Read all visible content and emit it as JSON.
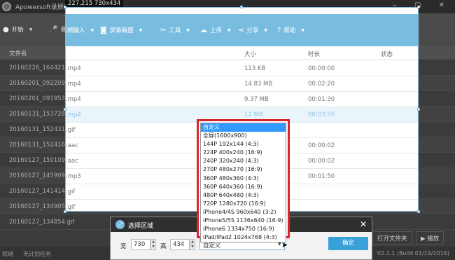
{
  "app": {
    "title": "Apowersoft录屏王",
    "window_controls": "‒ ▢ ✕"
  },
  "selection": {
    "coords_label": "227,215  730x434"
  },
  "toolbar": {
    "items": [
      {
        "label": "开始",
        "icon": "record-icon",
        "glyph": "●"
      },
      {
        "label": "音频输入",
        "icon": "microphone-icon",
        "glyph": "🎙"
      },
      {
        "label": "屏幕截图",
        "icon": "camera-icon",
        "glyph": "📷"
      },
      {
        "label": "工具",
        "icon": "tools-icon",
        "glyph": "✂"
      },
      {
        "label": "上传",
        "icon": "cloud-upload-icon",
        "glyph": "☁"
      },
      {
        "label": "分享",
        "icon": "share-icon",
        "glyph": "⋖"
      },
      {
        "label": "帮助",
        "icon": "help-icon",
        "glyph": "?"
      }
    ]
  },
  "table": {
    "headers": {
      "name": "文件名",
      "size": "大小",
      "duration": "时长",
      "status": "状态"
    },
    "rows": [
      {
        "name": "20160226_164421.mp4",
        "size": "113 KB",
        "duration": "00:00:00"
      },
      {
        "name": "20160201_092209.mp4",
        "size": "14.83 MB",
        "duration": "00:02:20"
      },
      {
        "name": "20160201_091953.mp4",
        "size": "9.37 MB",
        "duration": "00:01:30"
      },
      {
        "name": "20160131_153728.mp4",
        "size": "12 MB",
        "duration": "00:03:55"
      },
      {
        "name": "20160131_152431.gif",
        "size": "",
        "duration": ""
      },
      {
        "name": "20160131_152416.aac",
        "size": "",
        "duration": "00:00:02"
      },
      {
        "name": "20160127_150109.aac",
        "size": "",
        "duration": "00:00:02"
      },
      {
        "name": "20160127_145909.mp3",
        "size": "",
        "duration": "00:01:50"
      },
      {
        "name": "20160127_141414.gif",
        "size": "",
        "duration": ""
      },
      {
        "name": "20160127_134905.gif",
        "size": "",
        "duration": ""
      },
      {
        "name": "20160127_134854.gif",
        "size": "",
        "duration": ""
      }
    ]
  },
  "bottom": {
    "open_folder": "打开文件夹",
    "play": "▶ 播放",
    "status_left": "就绪",
    "status_task": "无计划任务",
    "version": "V2.1.1 (Build 01/19/2016)"
  },
  "dialog": {
    "title": "选择区域",
    "width_label": "宽",
    "width_value": "730",
    "height_label": "高",
    "height_value": "434",
    "preset_value": "自定义",
    "ok_label": "确定",
    "close": "✕"
  },
  "dropdown": {
    "options": [
      "自定义",
      "全屏(1600x900)",
      "144P 192x144 (4:3)",
      "224P 400x240 (16:9)",
      "240P 320x240 (4:3)",
      "270P 480x270 (16:9)",
      "360P 480x360 (4:3)",
      "360P 640x360 (16:9)",
      "480P 640x480 (4:3)",
      "720P 1280x720 (16:9)",
      "iPhone4/4S 960x640 (3:2)",
      "iPhone5/5S 1136x640 (16:9)",
      "iPhone6 1334x750 (16:9)",
      "iPad/iPad2 1024x768 (4:3)"
    ],
    "highlighted": "自定义"
  }
}
